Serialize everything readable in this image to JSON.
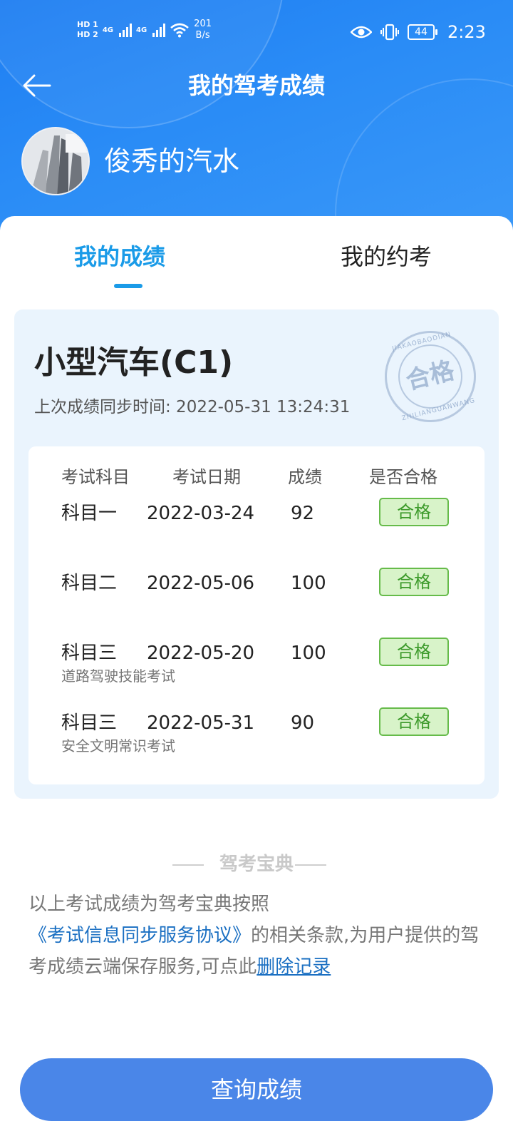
{
  "status_bar": {
    "hd1": "HD 1",
    "hd2": "HD 2",
    "net1": "4G",
    "net2": "4G",
    "speed_value": "201",
    "speed_unit": "B/s",
    "battery": "44",
    "time": "2:23"
  },
  "header": {
    "title": "我的驾考成绩",
    "username": "俊秀的汽水"
  },
  "tabs": [
    {
      "label": "我的成绩",
      "active": true
    },
    {
      "label": "我的约考",
      "active": false
    }
  ],
  "score_card": {
    "car_type": "小型汽车(C1)",
    "sync_label": "上次成绩同步时间: 2022-05-31 13:24:31",
    "stamp": {
      "text": "合格",
      "arc_top": "JIAKAOBAODIAN",
      "arc_bottom": "ZHILIANGUANWANG"
    },
    "columns": [
      "考试科目",
      "考试日期",
      "成绩",
      "是否合格"
    ],
    "rows": [
      {
        "subject": "科目一",
        "date": "2022-03-24",
        "score": "92",
        "result": "合格",
        "note": ""
      },
      {
        "subject": "科目二",
        "date": "2022-05-06",
        "score": "100",
        "result": "合格",
        "note": ""
      },
      {
        "subject": "科目三",
        "date": "2022-05-20",
        "score": "100",
        "result": "合格",
        "note": "道路驾驶技能考试"
      },
      {
        "subject": "科目三",
        "date": "2022-05-31",
        "score": "90",
        "result": "合格",
        "note": "安全文明常识考试"
      }
    ]
  },
  "footer": {
    "section_title": "驾考宝典",
    "notice_part1": "以上考试成绩为驾考宝典按照",
    "notice_link": "《考试信息同步服务协议》",
    "notice_part2": "的相关条款,为用户提供的驾考成绩云端保存服务,可点此",
    "delete_link": "删除记录",
    "button": "查询成绩"
  },
  "colors": {
    "header_blue": "#2a8cf6",
    "tab_active": "#1a9be8",
    "panel_bg": "#eaf4fd",
    "pass_green": "#66bb4a",
    "button_blue": "#4a86e8"
  }
}
